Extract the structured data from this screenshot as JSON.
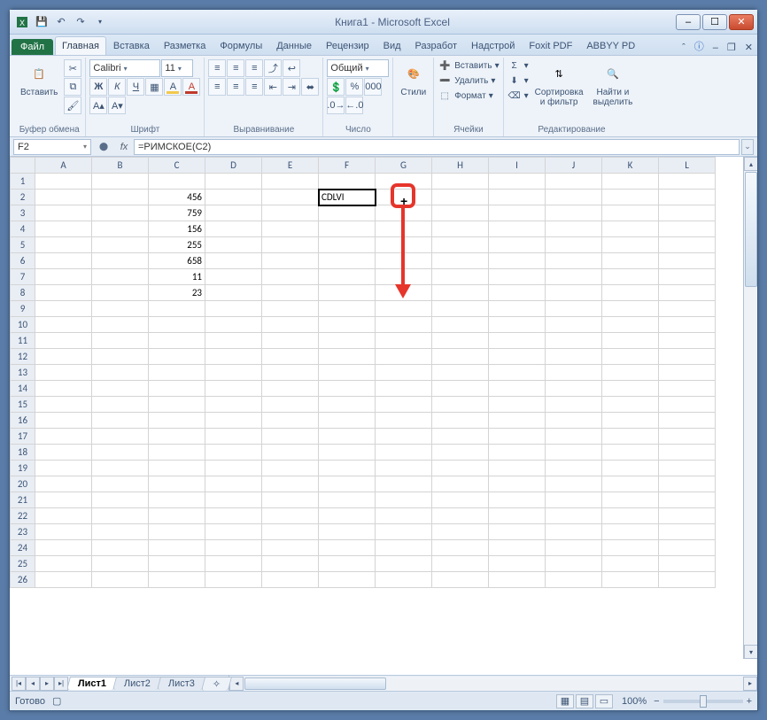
{
  "title": "Книга1  -  Microsoft Excel",
  "ribbon": {
    "file": "Файл",
    "tabs": [
      "Главная",
      "Вставка",
      "Разметка",
      "Формулы",
      "Данные",
      "Рецензир",
      "Вид",
      "Разработ",
      "Надстрой",
      "Foxit PDF",
      "ABBYY PD"
    ],
    "active_tab": 0,
    "groups": {
      "clipboard": {
        "label": "Буфер обмена",
        "paste": "Вставить"
      },
      "font": {
        "label": "Шрифт",
        "name": "Calibri",
        "size": "11"
      },
      "align": {
        "label": "Выравнивание"
      },
      "number": {
        "label": "Число",
        "format": "Общий"
      },
      "styles": {
        "label": "",
        "styles_btn": "Стили"
      },
      "cells": {
        "label": "Ячейки",
        "insert": "Вставить",
        "delete": "Удалить",
        "format": "Формат"
      },
      "editing": {
        "label": "Редактирование",
        "sort": "Сортировка\nи фильтр",
        "find": "Найти и\nвыделить"
      }
    }
  },
  "formula_bar": {
    "name": "F2",
    "formula": "=РИМСКОЕ(C2)"
  },
  "columns": [
    "A",
    "B",
    "C",
    "D",
    "E",
    "F",
    "G",
    "H",
    "I",
    "J",
    "K",
    "L"
  ],
  "rows": 26,
  "data_c": {
    "2": "456",
    "3": "759",
    "4": "156",
    "5": "255",
    "6": "658",
    "7": "11",
    "8": "23"
  },
  "data_f": {
    "2": "CDLVI"
  },
  "selected_cell": "F2",
  "sheets": {
    "nav": [
      "|◂",
      "◂",
      "▸",
      "▸|"
    ],
    "tabs": [
      "Лист1",
      "Лист2",
      "Лист3"
    ],
    "active": 0,
    "new": "+"
  },
  "status": {
    "ready": "Готово",
    "zoom": "100%"
  }
}
